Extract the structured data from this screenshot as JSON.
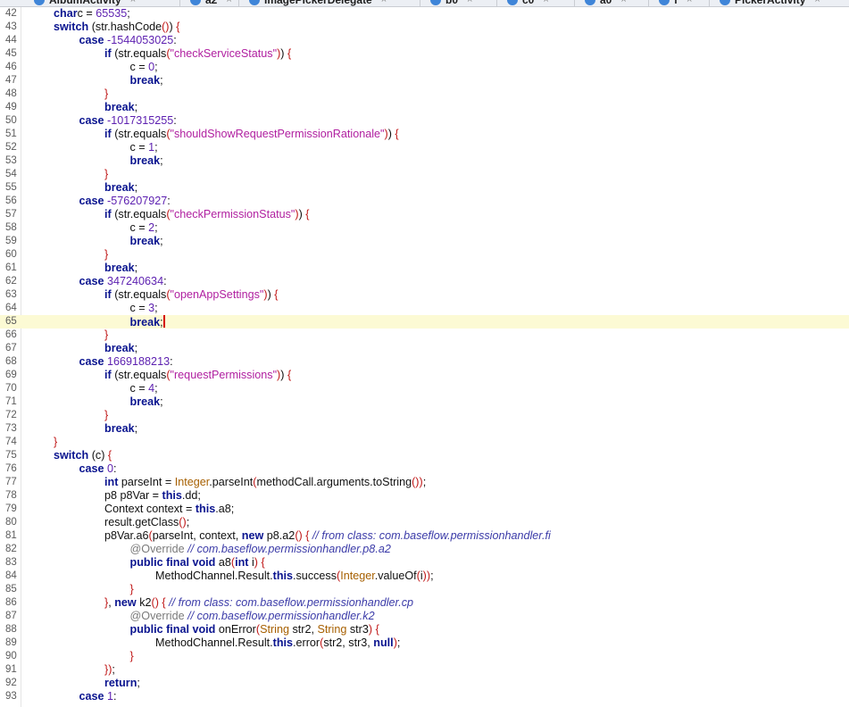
{
  "tabs": [
    {
      "label": "AlbumActivity"
    },
    {
      "label": "a2"
    },
    {
      "label": "ImagePickerDelegate"
    },
    {
      "label": "b0"
    },
    {
      "label": "c0"
    },
    {
      "label": "a0"
    },
    {
      "label": "f"
    },
    {
      "label": "PickerActivity"
    }
  ],
  "editor": {
    "current_line": 65,
    "lines": [
      {
        "n": "42",
        "indent": 1,
        "tokens": [
          [
            "kw",
            "char"
          ],
          [
            "",
            "c = "
          ],
          [
            "num",
            "65535"
          ],
          [
            "",
            ";"
          ]
        ]
      },
      {
        "n": "43",
        "indent": 1,
        "tokens": [
          [
            "kw",
            "switch"
          ],
          [
            "",
            " (str.hashCode"
          ],
          [
            "br",
            "()"
          ],
          [
            "",
            ") "
          ],
          [
            "br",
            "{"
          ]
        ]
      },
      {
        "n": "44",
        "indent": 2,
        "tokens": [
          [
            "kw",
            "case"
          ],
          [
            "",
            " "
          ],
          [
            "num",
            "-1544053025"
          ],
          [
            "",
            ":"
          ]
        ]
      },
      {
        "n": "45",
        "indent": 3,
        "tokens": [
          [
            "kw",
            "if"
          ],
          [
            "",
            " (str.equals"
          ],
          [
            "br",
            "("
          ],
          [
            "str",
            "\"checkServiceStatus\""
          ],
          [
            "br",
            ")"
          ],
          [
            ") ",
            ""
          ],
          [
            "br",
            "{"
          ]
        ]
      },
      {
        "n": "46",
        "indent": 4,
        "tokens": [
          [
            "",
            "c = "
          ],
          [
            "num",
            "0"
          ],
          [
            "",
            ";"
          ]
        ]
      },
      {
        "n": "47",
        "indent": 4,
        "tokens": [
          [
            "kw",
            "break"
          ],
          [
            "",
            ";"
          ]
        ]
      },
      {
        "n": "48",
        "indent": 3,
        "tokens": [
          [
            "br",
            "}"
          ]
        ]
      },
      {
        "n": "49",
        "indent": 3,
        "tokens": [
          [
            "kw",
            "break"
          ],
          [
            "",
            ";"
          ]
        ]
      },
      {
        "n": "50",
        "indent": 2,
        "tokens": [
          [
            "kw",
            "case"
          ],
          [
            "",
            " "
          ],
          [
            "num",
            "-1017315255"
          ],
          [
            "",
            ":"
          ]
        ]
      },
      {
        "n": "51",
        "indent": 3,
        "tokens": [
          [
            "kw",
            "if"
          ],
          [
            "",
            " (str.equals"
          ],
          [
            "br",
            "("
          ],
          [
            "str",
            "\"shouldShowRequestPermissionRationale\""
          ],
          [
            "br",
            ")"
          ],
          [
            "",
            ") "
          ],
          [
            "br",
            "{"
          ]
        ]
      },
      {
        "n": "52",
        "indent": 4,
        "tokens": [
          [
            "",
            "c = "
          ],
          [
            "num",
            "1"
          ],
          [
            "",
            ";"
          ]
        ]
      },
      {
        "n": "53",
        "indent": 4,
        "tokens": [
          [
            "kw",
            "break"
          ],
          [
            "",
            ";"
          ]
        ]
      },
      {
        "n": "54",
        "indent": 3,
        "tokens": [
          [
            "br",
            "}"
          ]
        ]
      },
      {
        "n": "55",
        "indent": 3,
        "tokens": [
          [
            "kw",
            "break"
          ],
          [
            "",
            ";"
          ]
        ]
      },
      {
        "n": "56",
        "indent": 2,
        "tokens": [
          [
            "kw",
            "case"
          ],
          [
            "",
            " "
          ],
          [
            "num",
            "-576207927"
          ],
          [
            "",
            ":"
          ]
        ]
      },
      {
        "n": "57",
        "indent": 3,
        "tokens": [
          [
            "kw",
            "if"
          ],
          [
            "",
            " (str.equals"
          ],
          [
            "br",
            "("
          ],
          [
            "str",
            "\"checkPermissionStatus\""
          ],
          [
            "br",
            ")"
          ],
          [
            "",
            ") "
          ],
          [
            "br",
            "{"
          ]
        ]
      },
      {
        "n": "58",
        "indent": 4,
        "tokens": [
          [
            "",
            "c = "
          ],
          [
            "num",
            "2"
          ],
          [
            "",
            ";"
          ]
        ]
      },
      {
        "n": "59",
        "indent": 4,
        "tokens": [
          [
            "kw",
            "break"
          ],
          [
            "",
            ";"
          ]
        ]
      },
      {
        "n": "60",
        "indent": 3,
        "tokens": [
          [
            "br",
            "}"
          ]
        ]
      },
      {
        "n": "61",
        "indent": 3,
        "tokens": [
          [
            "kw",
            "break"
          ],
          [
            "",
            ";"
          ]
        ]
      },
      {
        "n": "62",
        "indent": 2,
        "tokens": [
          [
            "kw",
            "case"
          ],
          [
            "",
            " "
          ],
          [
            "num",
            "347240634"
          ],
          [
            "",
            ":"
          ]
        ]
      },
      {
        "n": "63",
        "indent": 3,
        "tokens": [
          [
            "kw",
            "if"
          ],
          [
            "",
            " (str.equals"
          ],
          [
            "br",
            "("
          ],
          [
            "str",
            "\"openAppSettings\""
          ],
          [
            "br",
            ")"
          ],
          [
            "",
            ") "
          ],
          [
            "br",
            "{"
          ]
        ]
      },
      {
        "n": "64",
        "indent": 4,
        "tokens": [
          [
            "",
            "c = "
          ],
          [
            "num",
            "3"
          ],
          [
            "",
            ";"
          ]
        ]
      },
      {
        "n": "65",
        "indent": 4,
        "tokens": [
          [
            "kw",
            "break"
          ],
          [
            "",
            ";"
          ]
        ],
        "caret": true
      },
      {
        "n": "66",
        "indent": 3,
        "tokens": [
          [
            "br",
            "}"
          ]
        ]
      },
      {
        "n": "67",
        "indent": 3,
        "tokens": [
          [
            "kw",
            "break"
          ],
          [
            "",
            ";"
          ]
        ]
      },
      {
        "n": "68",
        "indent": 2,
        "tokens": [
          [
            "kw",
            "case"
          ],
          [
            "",
            " "
          ],
          [
            "num",
            "1669188213"
          ],
          [
            "",
            ":"
          ]
        ]
      },
      {
        "n": "69",
        "indent": 3,
        "tokens": [
          [
            "kw",
            "if"
          ],
          [
            "",
            " (str.equals"
          ],
          [
            "br",
            "("
          ],
          [
            "str",
            "\"requestPermissions\""
          ],
          [
            "br",
            ")"
          ],
          [
            "",
            ") "
          ],
          [
            "br",
            "{"
          ]
        ]
      },
      {
        "n": "70",
        "indent": 4,
        "tokens": [
          [
            "",
            "c = "
          ],
          [
            "num",
            "4"
          ],
          [
            "",
            ";"
          ]
        ]
      },
      {
        "n": "71",
        "indent": 4,
        "tokens": [
          [
            "kw",
            "break"
          ],
          [
            "",
            ";"
          ]
        ]
      },
      {
        "n": "72",
        "indent": 3,
        "tokens": [
          [
            "br",
            "}"
          ]
        ]
      },
      {
        "n": "73",
        "indent": 3,
        "tokens": [
          [
            "kw",
            "break"
          ],
          [
            "",
            ";"
          ]
        ]
      },
      {
        "n": "74",
        "indent": 1,
        "tokens": [
          [
            "br",
            "}"
          ]
        ]
      },
      {
        "n": "75",
        "indent": 1,
        "tokens": [
          [
            "kw",
            "switch"
          ],
          [
            "",
            " (c) "
          ],
          [
            "br",
            "{"
          ]
        ]
      },
      {
        "n": "76",
        "indent": 2,
        "tokens": [
          [
            "kw",
            "case"
          ],
          [
            "",
            " "
          ],
          [
            "num",
            "0"
          ],
          [
            "",
            ":"
          ]
        ]
      },
      {
        "n": "77",
        "indent": 3,
        "tokens": [
          [
            "kw",
            "int"
          ],
          [
            "",
            " parseInt = "
          ],
          [
            "cls",
            "Integer"
          ],
          [
            "",
            ".parseInt"
          ],
          [
            "br",
            "("
          ],
          [
            "",
            "methodCall.arguments.toString"
          ],
          [
            "br",
            "()"
          ],
          [
            "br",
            ")"
          ],
          [
            "",
            ";"
          ]
        ]
      },
      {
        "n": "78",
        "indent": 3,
        "tokens": [
          [
            "",
            "p8 p8Var = "
          ],
          [
            "kw",
            "this"
          ],
          [
            "",
            ".dd;"
          ]
        ]
      },
      {
        "n": "79",
        "indent": 3,
        "tokens": [
          [
            "",
            "Context context = "
          ],
          [
            "kw",
            "this"
          ],
          [
            "",
            ".a8;"
          ]
        ]
      },
      {
        "n": "80",
        "indent": 3,
        "tokens": [
          [
            "",
            "result.getClass"
          ],
          [
            "br",
            "()"
          ],
          [
            "",
            ";"
          ]
        ]
      },
      {
        "n": "81",
        "indent": 3,
        "tokens": [
          [
            "",
            "p8Var.a6"
          ],
          [
            "br",
            "("
          ],
          [
            "",
            "parseInt, context, "
          ],
          [
            "kw",
            "new"
          ],
          [
            "",
            " p8.a2"
          ],
          [
            "br",
            "()"
          ],
          [
            "",
            " "
          ],
          [
            "br",
            "{"
          ],
          [
            "",
            " "
          ],
          [
            "cmt",
            "// from class: com.baseflow.permissionhandler.fi"
          ]
        ]
      },
      {
        "n": "82",
        "indent": 4,
        "tokens": [
          [
            "ann",
            "@Override"
          ],
          [
            "",
            " "
          ],
          [
            "cmt",
            "// com.baseflow.permissionhandler.p8.a2"
          ]
        ]
      },
      {
        "n": "83",
        "indent": 4,
        "tokens": [
          [
            "kw",
            "public final void"
          ],
          [
            "",
            " a8"
          ],
          [
            "br",
            "("
          ],
          [
            "kw",
            "int"
          ],
          [
            "",
            " i"
          ],
          [
            "br",
            ")"
          ],
          [
            "",
            " "
          ],
          [
            "br",
            "{"
          ]
        ]
      },
      {
        "n": "84",
        "indent": 5,
        "tokens": [
          [
            "",
            "MethodChannel.Result."
          ],
          [
            "kw",
            "this"
          ],
          [
            "",
            ".success"
          ],
          [
            "br",
            "("
          ],
          [
            "cls",
            "Integer"
          ],
          [
            "",
            ".valueOf"
          ],
          [
            "br",
            "("
          ],
          [
            "",
            "i"
          ],
          [
            "br",
            ")"
          ],
          [
            "br",
            ")"
          ],
          [
            "",
            ";"
          ]
        ]
      },
      {
        "n": "85",
        "indent": 4,
        "tokens": [
          [
            "br",
            "}"
          ]
        ]
      },
      {
        "n": "86",
        "indent": 3,
        "tokens": [
          [
            "br",
            "}"
          ],
          [
            "",
            ", "
          ],
          [
            "kw",
            "new"
          ],
          [
            "",
            " k2"
          ],
          [
            "br",
            "()"
          ],
          [
            "",
            " "
          ],
          [
            "br",
            "{"
          ],
          [
            "",
            " "
          ],
          [
            "cmt",
            "// from class: com.baseflow.permissionhandler.cp"
          ]
        ]
      },
      {
        "n": "87",
        "indent": 4,
        "tokens": [
          [
            "ann",
            "@Override"
          ],
          [
            "",
            " "
          ],
          [
            "cmt",
            "// com.baseflow.permissionhandler.k2"
          ]
        ]
      },
      {
        "n": "88",
        "indent": 4,
        "tokens": [
          [
            "kw",
            "public final void"
          ],
          [
            "",
            " onError"
          ],
          [
            "br",
            "("
          ],
          [
            "cls",
            "String"
          ],
          [
            "",
            " str2, "
          ],
          [
            "cls",
            "String"
          ],
          [
            "",
            " str3"
          ],
          [
            "br",
            ")"
          ],
          [
            "",
            " "
          ],
          [
            "br",
            "{"
          ]
        ]
      },
      {
        "n": "89",
        "indent": 5,
        "tokens": [
          [
            "",
            "MethodChannel.Result."
          ],
          [
            "kw",
            "this"
          ],
          [
            "",
            ".error"
          ],
          [
            "br",
            "("
          ],
          [
            "",
            "str2, str3, "
          ],
          [
            "kw",
            "null"
          ],
          [
            "br",
            ")"
          ],
          [
            "",
            ";"
          ]
        ]
      },
      {
        "n": "90",
        "indent": 4,
        "tokens": [
          [
            "br",
            "}"
          ]
        ]
      },
      {
        "n": "91",
        "indent": 3,
        "tokens": [
          [
            "br",
            "}"
          ],
          [
            "br",
            ")"
          ],
          [
            "",
            ";"
          ]
        ]
      },
      {
        "n": "92",
        "indent": 3,
        "tokens": [
          [
            "kw",
            "return"
          ],
          [
            "",
            ";"
          ]
        ]
      },
      {
        "n": "93",
        "indent": 2,
        "tokens": [
          [
            "kw",
            "case"
          ],
          [
            "",
            " "
          ],
          [
            "num",
            "1"
          ],
          [
            "",
            ":"
          ]
        ]
      }
    ]
  }
}
